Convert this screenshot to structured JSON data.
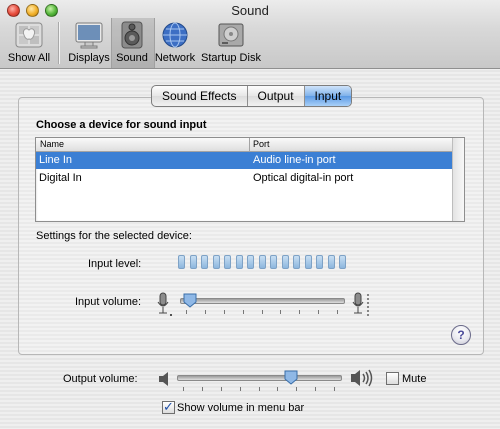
{
  "window": {
    "title": "Sound"
  },
  "toolbar": {
    "items": [
      {
        "label": "Show All",
        "icon": "apple-prefs-icon"
      },
      {
        "label": "Displays",
        "icon": "display-icon"
      },
      {
        "label": "Sound",
        "icon": "speaker-icon",
        "selected": true
      },
      {
        "label": "Network",
        "icon": "network-globe-icon"
      },
      {
        "label": "Startup Disk",
        "icon": "hard-disk-icon"
      }
    ]
  },
  "tabs": [
    {
      "label": "Sound Effects",
      "active": false
    },
    {
      "label": "Output",
      "active": false
    },
    {
      "label": "Input",
      "active": true
    }
  ],
  "input": {
    "heading": "Choose a device for sound input",
    "columns": [
      "Name",
      "Port"
    ],
    "devices": [
      {
        "name": "Line In",
        "port": "Audio line-in port",
        "selected": true
      },
      {
        "name": "Digital In",
        "port": "Optical digital-in port",
        "selected": false
      }
    ],
    "settings_label": "Settings for the selected device:",
    "input_level_label": "Input level:",
    "input_level_segments": 15,
    "input_level_active": 0,
    "input_volume_label": "Input volume:",
    "input_volume_fraction": 0.02
  },
  "output": {
    "volume_label": "Output volume:",
    "volume_fraction": 0.72,
    "mute_label": "Mute",
    "mute_checked": false,
    "show_in_menubar_label": "Show volume in menu bar",
    "show_in_menubar_checked": true
  },
  "colors": {
    "selection": "#3b7fd4",
    "active_tab": "#5c9ae4"
  }
}
